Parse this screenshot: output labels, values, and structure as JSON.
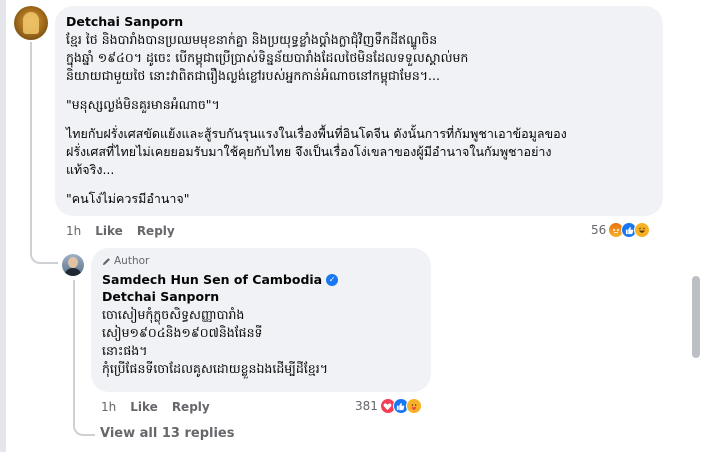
{
  "comment": {
    "author": "Detchai Sanporn",
    "lines": [
      "ខ្មែរ ថៃ និងបារាំងបានប្រឈមមុខនាក់គ្នា និងប្រយុទ្ធខ្លាំងប្ដាំងក្លាជុំវិញទឹកដីឥណ្ឌូចិន",
      "ក្នុងឆ្នាំ ១៩៤០។ ដូចេះ បើកម្ពុជាប្រើប្រាស់ទិន្នន័យបារាំងដែលថៃមិនដែលទទួលស្គាល់មក",
      "និយាយជាមួយថៃ នោះវាពិតជារឿងល្ងង់ខ្លៅរបស់អ្នកកាន់អំណាចនៅកម្ពុជាមែន។...",
      "\"មនុស្សល្ងង់មិនគួរមានអំណាច\"។",
      "ไทยกับฝรั่งเศสขัดแย้งและสู้รบกันรุนแรงในเรื่องพื้นที่อินโดจีน ดังนั้นการที่กัมพูชาเอาข้อมูลของ",
      "ฝรั่งเศสที่ไทยไม่เคยยอมรับมาใช้คุยกับไทย จึงเป็นเรื่องโง่เขลาของผู้มีอำนาจในกัมพูชาอย่าง",
      "แท้จริง...",
      "\"คนโง่ไม่ควรมีอำนาจ\""
    ],
    "time": "1h",
    "like_label": "Like",
    "reply_label": "Reply",
    "reaction_count": "56",
    "reaction_icons": [
      "angry-icon",
      "like-icon",
      "haha-icon"
    ]
  },
  "reply": {
    "author_tag": "Author",
    "author": "Samdech Hun Sen of Cambodia",
    "verified_icon": "verified-badge-icon",
    "mention": "Detchai Sanporn",
    "lines": [
      "ចោសៀមកុំក្លុចសិទ្ធសញ្ញាបារាំង",
      "សៀម១៩០៤និង១៩០៧និងផែនទី",
      "នោះផង។",
      "កុំប្រើផែនទីចោដែលគូសដោយខ្លួនឯងដើម្បីដីខ្មែរ។"
    ],
    "time": "1h",
    "like_label": "Like",
    "reply_label": "Reply",
    "reaction_count": "381",
    "reaction_icons": [
      "love-icon",
      "like-icon",
      "care-icon"
    ]
  },
  "view_replies": "View all 13 replies",
  "colors": {
    "bubble": "#f0f2f5",
    "secondary_text": "#65676b",
    "verified": "#1877f2",
    "like": "#1877f2",
    "love": "#f33e58",
    "angry": "#e9710f"
  }
}
